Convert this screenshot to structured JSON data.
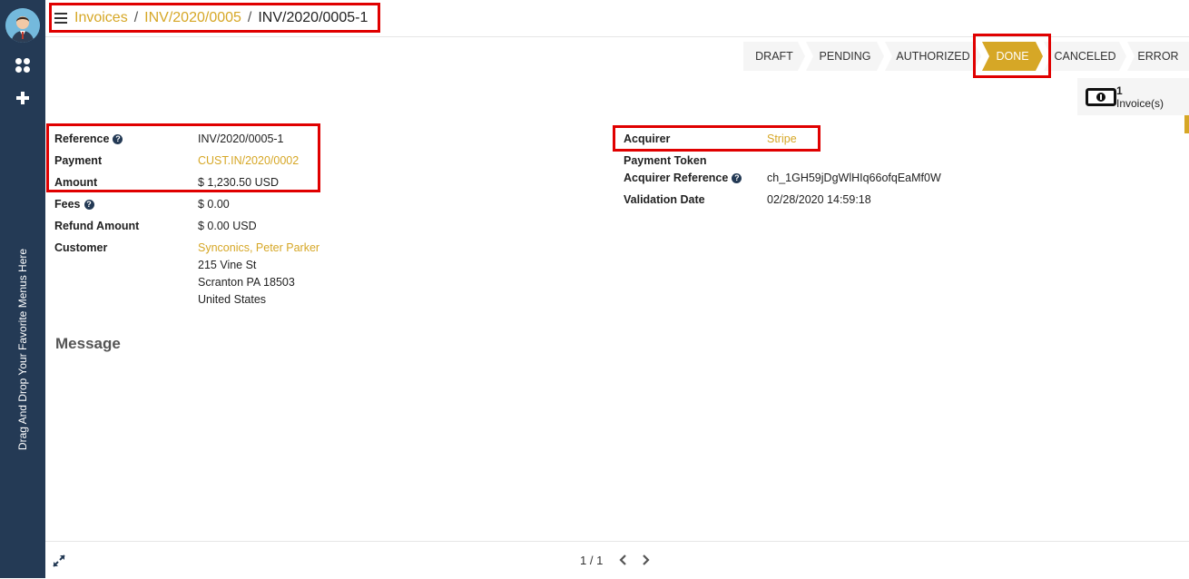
{
  "sidebar": {
    "favorites_hint": "Drag And Drop Your Favorite Menus Here"
  },
  "breadcrumb": {
    "items": [
      "Invoices",
      "INV/2020/0005"
    ],
    "current": "INV/2020/0005-1",
    "separator": "/"
  },
  "statusbar": {
    "stages": [
      "DRAFT",
      "PENDING",
      "AUTHORIZED",
      "DONE",
      "CANCELED",
      "ERROR"
    ],
    "active": "DONE"
  },
  "smart_button": {
    "count": "1",
    "label": "Invoice(s)"
  },
  "left_fields": {
    "reference": {
      "label": "Reference",
      "value": "INV/2020/0005-1"
    },
    "payment": {
      "label": "Payment",
      "value": "CUST.IN/2020/0002"
    },
    "amount": {
      "label": "Amount",
      "value": "$ 1,230.50",
      "currency": "USD"
    },
    "fees": {
      "label": "Fees",
      "value": "$ 0.00"
    },
    "refund_amount": {
      "label": "Refund Amount",
      "value": "$ 0.00",
      "currency": "USD"
    },
    "customer": {
      "label": "Customer",
      "name": "Synconics, Peter Parker",
      "street": "215 Vine St",
      "city": "Scranton PA 18503",
      "country": "United States"
    }
  },
  "right_fields": {
    "acquirer": {
      "label": "Acquirer",
      "value": "Stripe"
    },
    "payment_token": {
      "label": "Payment Token",
      "value": ""
    },
    "acquirer_reference": {
      "label": "Acquirer Reference",
      "value": "ch_1GH59jDgWlHIq66ofqEaMf0W"
    },
    "validation_date": {
      "label": "Validation Date",
      "value": "02/28/2020 14:59:18"
    }
  },
  "message": {
    "title": "Message"
  },
  "pager": {
    "value": "1 / 1"
  },
  "colors": {
    "accent": "#d6a726",
    "sidebar": "#243a55",
    "highlight": "#e00000"
  },
  "help_glyph": "?"
}
